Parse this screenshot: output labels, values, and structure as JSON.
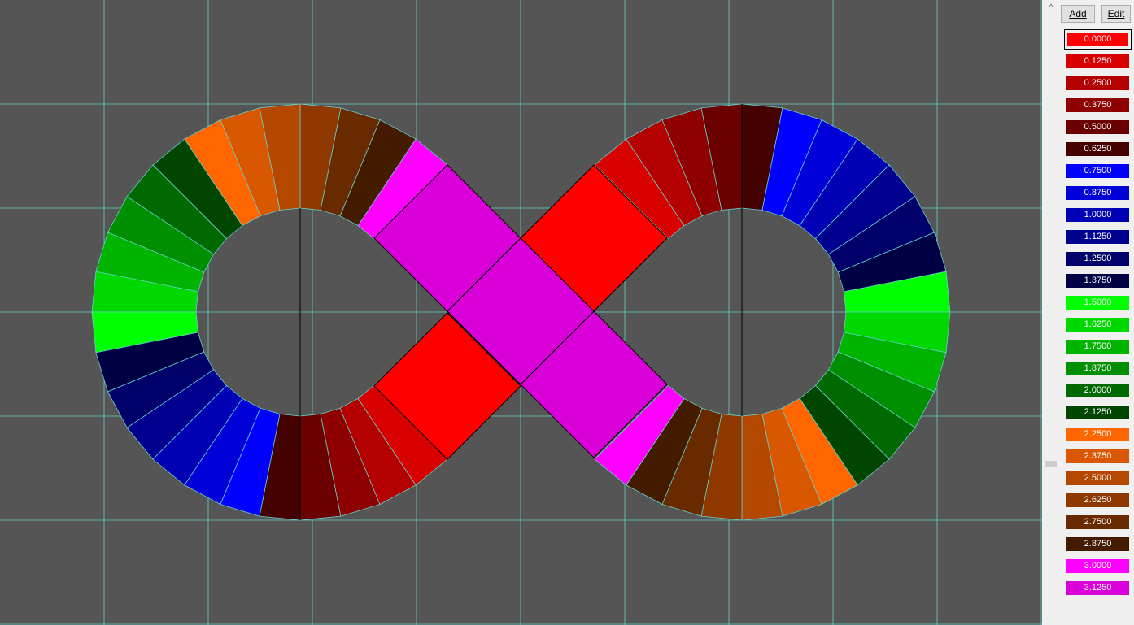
{
  "toolbar": {
    "add_label": "Add",
    "edit_label": "Edit"
  },
  "scroll": {
    "up_icon": "chevron-up-icon",
    "up_glyph": "^"
  },
  "grid_color": "#66d0c8",
  "canvas_background": "#555555",
  "swatches": [
    {
      "label": "0.0000",
      "color": "#ff0000",
      "selected": true
    },
    {
      "label": "0.1250",
      "color": "#d90000"
    },
    {
      "label": "0.2500",
      "color": "#b40000"
    },
    {
      "label": "0.3750",
      "color": "#8f0000"
    },
    {
      "label": "0.5000",
      "color": "#6a0000"
    },
    {
      "label": "0.6250",
      "color": "#450000"
    },
    {
      "label": "0.7500",
      "color": "#0000ff"
    },
    {
      "label": "0.8750",
      "color": "#0000d9"
    },
    {
      "label": "1.0000",
      "color": "#0000b4"
    },
    {
      "label": "1.1250",
      "color": "#00008f"
    },
    {
      "label": "1.2500",
      "color": "#00006a"
    },
    {
      "label": "1.3750",
      "color": "#000045"
    },
    {
      "label": "1.5000",
      "color": "#00ff00"
    },
    {
      "label": "1.6250",
      "color": "#00d900"
    },
    {
      "label": "1.7500",
      "color": "#00b400"
    },
    {
      "label": "1.8750",
      "color": "#008f00"
    },
    {
      "label": "2.0000",
      "color": "#006a00"
    },
    {
      "label": "2.1250",
      "color": "#004500"
    },
    {
      "label": "2.2500",
      "color": "#ff6600"
    },
    {
      "label": "2.3750",
      "color": "#d95700"
    },
    {
      "label": "2.5000",
      "color": "#b44800"
    },
    {
      "label": "2.6250",
      "color": "#8f3900"
    },
    {
      "label": "2.7500",
      "color": "#6a2a00"
    },
    {
      "label": "2.8750",
      "color": "#451b00"
    },
    {
      "label": "3.0000",
      "color": "#ff00ff"
    },
    {
      "label": "3.1250",
      "color": "#d900d9"
    }
  ]
}
